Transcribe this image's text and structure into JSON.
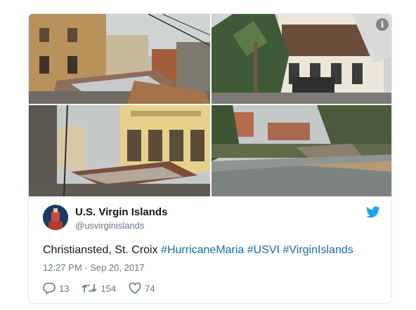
{
  "tweet": {
    "name": "U.S. Virgin Islands",
    "handle": "@usvirginislands",
    "text_plain": "Christiansted, St. Croix",
    "hashtags": [
      "#HurricaneMaria",
      "#USVI",
      "#VirginIslands"
    ],
    "timestamp": "12:27 PM - Sep 20, 2017",
    "reply_count": "13",
    "retweet_count": "154",
    "like_count": "74"
  },
  "icons": {
    "info": "i",
    "bird_color": "#1da1f2",
    "hashtag_color": "#1b6aa5"
  }
}
